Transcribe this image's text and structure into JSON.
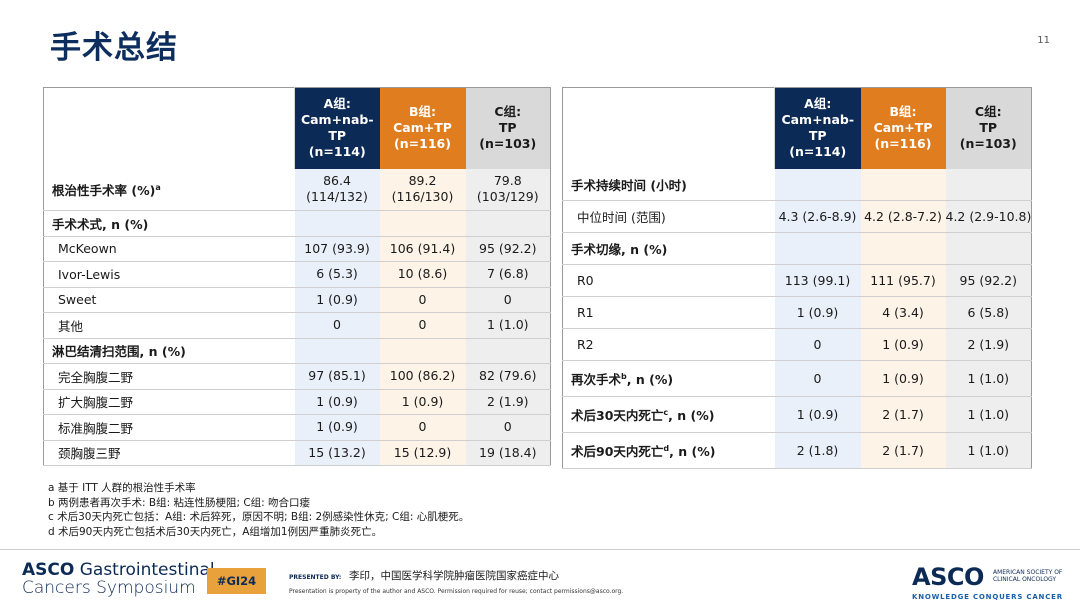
{
  "page": {
    "title": "手术总结",
    "page_number": "11"
  },
  "headers": {
    "a": [
      "A组:",
      "Cam+nab-TP",
      "(n=114)"
    ],
    "b": [
      "B组:",
      "Cam+TP",
      "(n=116)"
    ],
    "c": [
      "C组:",
      "TP",
      "(n=103)"
    ]
  },
  "left_table": {
    "rows": [
      {
        "label": "根治性手术率 (%)",
        "sup": "a",
        "bold": true,
        "a": [
          "86.4",
          "(114/132)"
        ],
        "b": [
          "89.2",
          "(116/130)"
        ],
        "c": [
          "79.8",
          "(103/129)"
        ]
      },
      {
        "label": "手术术式, n (%)",
        "bold": true,
        "a": "",
        "b": "",
        "c": ""
      },
      {
        "label": "McKeown",
        "bold": false,
        "a": "107 (93.9)",
        "b": "106 (91.4)",
        "c": "95 (92.2)"
      },
      {
        "label": "Ivor-Lewis",
        "bold": false,
        "a": "6 (5.3)",
        "b": "10 (8.6)",
        "c": "7 (6.8)"
      },
      {
        "label": "Sweet",
        "bold": false,
        "a": "1 (0.9)",
        "b": "0",
        "c": "0"
      },
      {
        "label": "其他",
        "bold": false,
        "a": "0",
        "b": "0",
        "c": "1 (1.0)"
      },
      {
        "label": "淋巴结清扫范围, n (%)",
        "bold": true,
        "a": "",
        "b": "",
        "c": ""
      },
      {
        "label": "完全胸腹二野",
        "bold": false,
        "a": "97 (85.1)",
        "b": "100 (86.2)",
        "c": "82 (79.6)"
      },
      {
        "label": "扩大胸腹二野",
        "bold": false,
        "a": "1 (0.9)",
        "b": "1 (0.9)",
        "c": "2 (1.9)"
      },
      {
        "label": "标准胸腹二野",
        "bold": false,
        "a": "1 (0.9)",
        "b": "0",
        "c": "0"
      },
      {
        "label": "颈胸腹三野",
        "bold": false,
        "a": "15 (13.2)",
        "b": "15 (12.9)",
        "c": "19 (18.4)"
      }
    ]
  },
  "right_table": {
    "rows": [
      {
        "label": "手术持续时间 (小时)",
        "bold": true,
        "a": "",
        "b": "",
        "c": ""
      },
      {
        "label": "中位时间 (范围)",
        "bold": false,
        "a": "4.3 (2.6-8.9)",
        "b": "4.2 (2.8-7.2)",
        "c": "4.2 (2.9-10.8)"
      },
      {
        "label": "手术切缘, n (%)",
        "bold": true,
        "a": "",
        "b": "",
        "c": ""
      },
      {
        "label": "R0",
        "bold": false,
        "a": "113 (99.1)",
        "b": "111 (95.7)",
        "c": "95 (92.2)"
      },
      {
        "label": "R1",
        "bold": false,
        "a": "1 (0.9)",
        "b": "4 (3.4)",
        "c": "6 (5.8)"
      },
      {
        "label": "R2",
        "bold": false,
        "a": "0",
        "b": "1 (0.9)",
        "c": "2 (1.9)"
      },
      {
        "label": "再次手术",
        "sup": "b",
        "label_suffix": ", n (%)",
        "bold": true,
        "a": "0",
        "b": "1 (0.9)",
        "c": "1 (1.0)"
      },
      {
        "label": "术后30天内死亡",
        "sup": "c",
        "label_suffix": ", n (%)",
        "bold": true,
        "a": "1 (0.9)",
        "b": "2 (1.7)",
        "c": "1 (1.0)"
      },
      {
        "label": "术后90天内死亡",
        "sup": "d",
        "label_suffix": ", n (%)",
        "bold": true,
        "a": "2 (1.8)",
        "b": "2 (1.7)",
        "c": "1 (1.0)"
      }
    ]
  },
  "footnotes": [
    "a  基于 ITT 人群的根治性手术率",
    "b 两例患者再次手术: B组: 粘连性肠梗阻; C组: 吻合口瘘",
    "c 术后30天内死亡包括：A组: 术后猝死，原因不明; B组: 2例感染性休克; C组: 心肌梗死。",
    "d 术后90天内死亡包括术后30天内死亡，A组增加1例因严重肺炎死亡。"
  ],
  "footer": {
    "asco_gi_line1_bold": "ASCO",
    "asco_gi_line1": " Gastrointestinal",
    "asco_gi_line2": "Cancers Symposium",
    "hashtag": "#GI24",
    "presented_by": "PRESENTED BY:",
    "presenter": "李印，中国医学科学院肿瘤医院国家癌症中心",
    "property_note": "Presentation is property of the author and ASCO. Permission required for reuse; contact permissions@asco.org.",
    "asco_logo": "ASCO",
    "society_line1": "AMERICAN SOCIETY OF",
    "society_line2": "CLINICAL ONCOLOGY",
    "tagline": "KNOWLEDGE CONQUERS CANCER"
  }
}
